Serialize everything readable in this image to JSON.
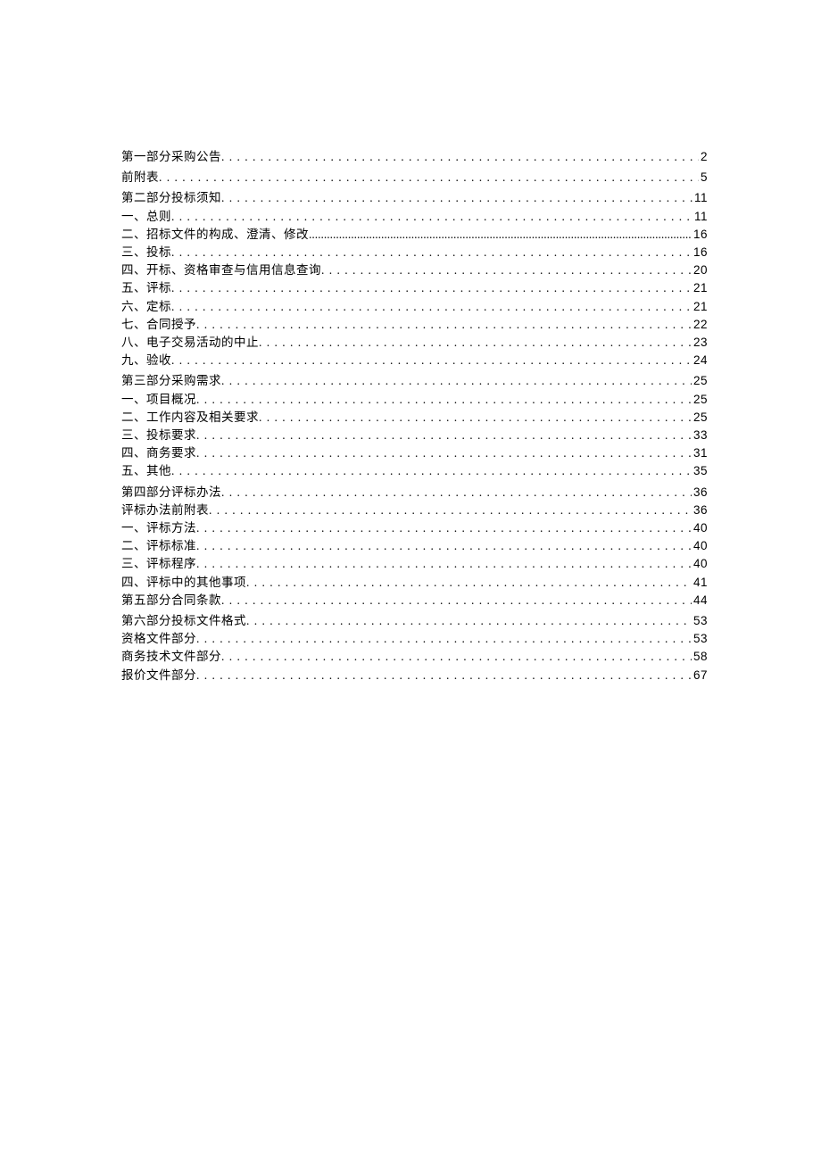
{
  "toc": [
    {
      "title": "第一部分采购公告",
      "page": "2",
      "section_start": true,
      "tight": false
    },
    {
      "title": "前附表",
      "page": "5",
      "section_start": true,
      "tight": false
    },
    {
      "title": "第二部分投标须知",
      "page": "11",
      "section_start": true,
      "tight": false
    },
    {
      "title": "一、总则",
      "page": "11",
      "section_start": false,
      "tight": false
    },
    {
      "title": "二、招标文件的构成、澄清、修改",
      "page": "16",
      "section_start": false,
      "tight": true
    },
    {
      "title": "三、投标",
      "page": "16",
      "section_start": false,
      "tight": false
    },
    {
      "title": "四、开标、资格审查与信用信息查询",
      "page": "20",
      "section_start": false,
      "tight": false
    },
    {
      "title": "五、评标",
      "page": "21",
      "section_start": false,
      "tight": false
    },
    {
      "title": "六、定标",
      "page": "21",
      "section_start": false,
      "tight": false
    },
    {
      "title": "七、合同授予",
      "page": "22",
      "section_start": false,
      "tight": false
    },
    {
      "title": "八、电子交易活动的中止",
      "page": "23",
      "section_start": false,
      "tight": false
    },
    {
      "title": "九、验收",
      "page": "24",
      "section_start": false,
      "tight": false
    },
    {
      "title": "第三部分采购需求",
      "page": "25",
      "section_start": true,
      "tight": false
    },
    {
      "title": "一、项目概况",
      "page": "25",
      "section_start": false,
      "tight": false
    },
    {
      "title": "二、工作内容及相关要求",
      "page": "25",
      "section_start": false,
      "tight": false
    },
    {
      "title": "三、投标要求",
      "page": "33",
      "section_start": false,
      "tight": false
    },
    {
      "title": "四、商务要求",
      "page": "31",
      "section_start": false,
      "tight": false
    },
    {
      "title": "五、其他",
      "page": "35",
      "section_start": false,
      "tight": false
    },
    {
      "title": "第四部分评标办法",
      "page": "36",
      "section_start": true,
      "tight": false
    },
    {
      "title": "评标办法前附表",
      "page": "36",
      "section_start": false,
      "tight": false
    },
    {
      "title": "一、评标方法",
      "page": "40",
      "section_start": false,
      "tight": false
    },
    {
      "title": "二、评标标准",
      "page": "40",
      "section_start": false,
      "tight": false
    },
    {
      "title": "三、评标程序",
      "page": "40",
      "section_start": false,
      "tight": false
    },
    {
      "title": "四、评标中的其他事项",
      "page": "41",
      "section_start": false,
      "tight": false
    },
    {
      "title": "第五部分合同条款",
      "page": "44",
      "section_start": false,
      "tight": false
    },
    {
      "title": "第六部分投标文件格式",
      "page": "53",
      "section_start": true,
      "tight": false
    },
    {
      "title": "资格文件部分",
      "page": "53",
      "section_start": false,
      "tight": false
    },
    {
      "title": "商务技术文件部分",
      "page": "58",
      "section_start": false,
      "tight": false
    },
    {
      "title": "报价文件部分",
      "page": "67",
      "section_start": false,
      "tight": false
    }
  ]
}
